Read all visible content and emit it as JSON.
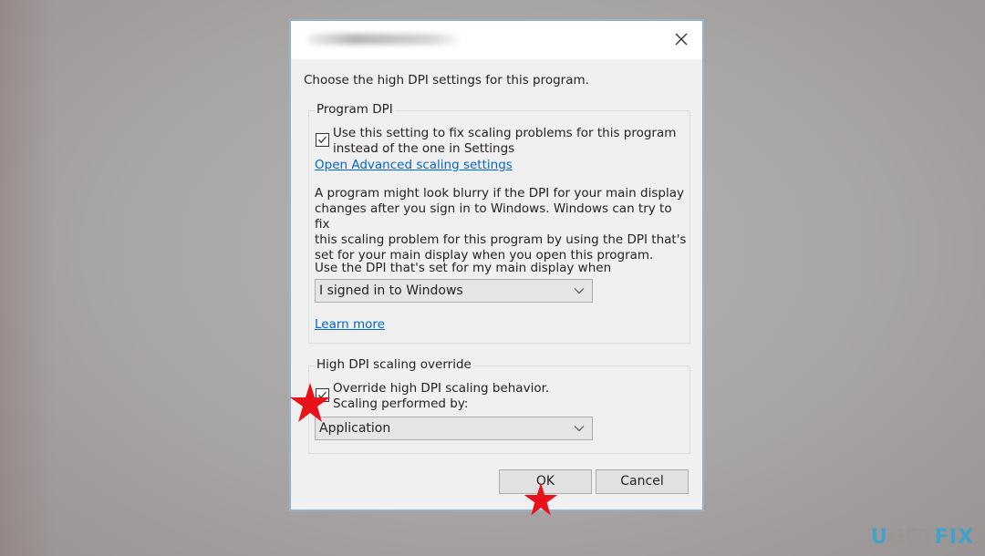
{
  "dialog": {
    "title": "",
    "close_icon": "close-x-icon",
    "intro": "Choose the high DPI settings for this program."
  },
  "program_dpi": {
    "legend": "Program DPI",
    "checkbox_checked": true,
    "checkbox_line1": "Use this setting to fix scaling problems for this program",
    "checkbox_line2": "instead of the one in Settings",
    "advanced_link": "Open Advanced scaling settings",
    "description": [
      "A program might look blurry if the DPI for your main display",
      "changes after you sign in to Windows. Windows can try to fix",
      "this scaling problem for this program by using the DPI that's",
      "set for your main display when you open this program."
    ],
    "select_label": "Use the DPI that's set for my main display when",
    "select_value": "I signed in to Windows",
    "learn_more": "Learn more"
  },
  "override": {
    "legend": "High DPI scaling override",
    "checkbox_checked": true,
    "checkbox_line1": "Override high DPI scaling behavior.",
    "checkbox_line2": "Scaling performed by:",
    "select_value": "Application"
  },
  "buttons": {
    "ok": "OK",
    "cancel": "Cancel"
  },
  "annotations": {
    "star_color": "#e8121a",
    "stars": [
      "override-checkbox",
      "ok-button"
    ]
  },
  "watermark": {
    "part1": "U",
    "part2": "GET",
    "part3": "FIX",
    "accent": "#3fa3c9"
  }
}
